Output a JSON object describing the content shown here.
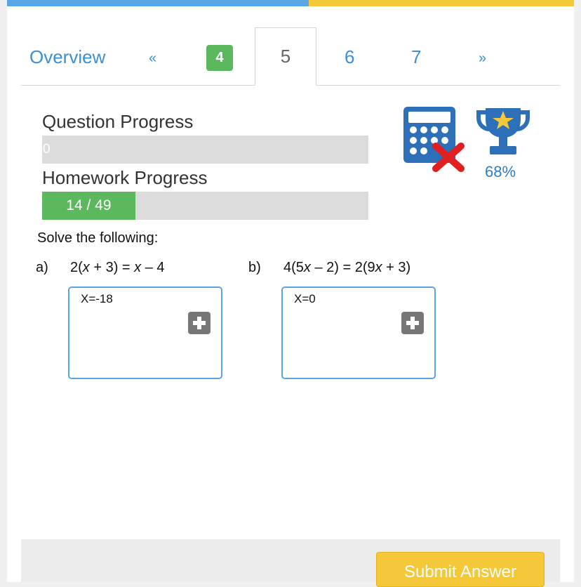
{
  "tabs": {
    "overview": "Overview",
    "prev": "«",
    "items": [
      "4",
      "5",
      "6",
      "7"
    ],
    "next": "»"
  },
  "progress": {
    "question_label": "Question Progress",
    "question_value": "0",
    "question_fraction": 0,
    "homework_label": "Homework Progress",
    "homework_value": "14 / 49",
    "homework_fraction": 0.2857
  },
  "score": {
    "percent": "68%"
  },
  "icons": {
    "calculator": "calculator-not-allowed-icon",
    "trophy": "trophy-icon"
  },
  "colors": {
    "accent": "#3b8fd4",
    "success": "#5cb85c",
    "warning": "#f5c83a"
  },
  "instruction": "Solve the following:",
  "questions": [
    {
      "letter": "a)",
      "equation": "2(x + 3) = x – 4",
      "answer": "X=-18"
    },
    {
      "letter": "b)",
      "equation": "4(5x – 2) = 2(9x + 3)",
      "answer": "X=0"
    }
  ],
  "footer": {
    "submit_label": "Submit Answer"
  }
}
